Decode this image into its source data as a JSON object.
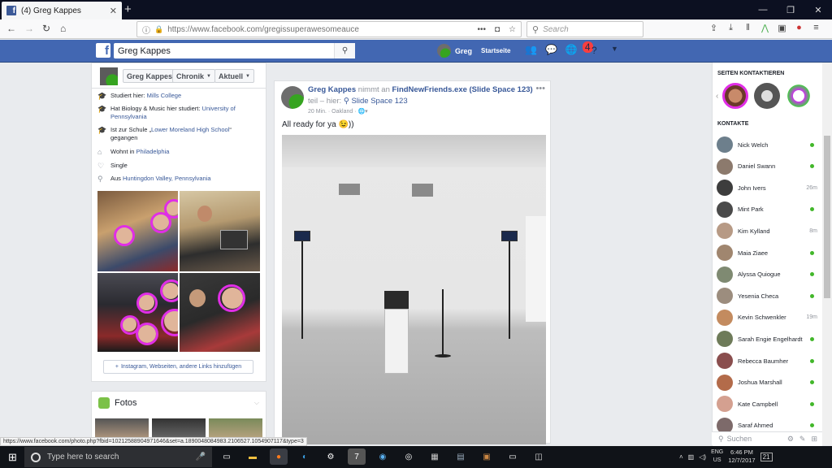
{
  "browser": {
    "tab_title": "(4) Greg Kappes",
    "url": "https://www.facebook.com/gregissuperawesomeauce",
    "search_placeholder": "Search",
    "status_url": "https://www.facebook.com/photo.php?fbid=10212588904971646&set=a.1890048084983.2106527.1054907117&type=3"
  },
  "fb_header": {
    "search_value": "Greg Kappes",
    "user_name": "Greg",
    "home_label": "Startseite",
    "notification_count": "4"
  },
  "profile_header": {
    "name": "Greg Kappes",
    "timeline": "Chronik",
    "current": "Aktuell"
  },
  "intro": [
    {
      "icon": "graduation-cap-icon",
      "text": "Studiert hier: ",
      "link": "Mills College",
      "after": ""
    },
    {
      "icon": "graduation-cap-icon",
      "text": "Hat Biology & Music hier studiert: ",
      "link": "University of Pennsylvania",
      "after": ""
    },
    {
      "icon": "graduation-cap-icon",
      "text": "Ist zur Schule „",
      "link": "Lower Moreland High School",
      "after": "“ gegangen"
    },
    {
      "icon": "home-icon",
      "text": "Wohnt in ",
      "link": "Philadelphia",
      "after": ""
    },
    {
      "icon": "heart-icon",
      "text": "Single",
      "link": "",
      "after": ""
    },
    {
      "icon": "location-pin-icon",
      "text": "Aus ",
      "link": "Huntingdon Valley, Pennsylvania",
      "after": ""
    }
  ],
  "add_links_label": "Instagram, Webseiten, andere Links hinzufügen",
  "fotos_label": "Fotos",
  "post": {
    "author": "Greg Kappes",
    "action_text": " nimmt an ",
    "event": "FindNewFriends.exe (Slide Space 123)",
    "at_prefix": "teil – hier: ",
    "place": "Slide Space 123",
    "meta": "20 Min. · Oakland · ",
    "message": "All ready for ya 😉))"
  },
  "sidebar": {
    "pages_title": "SEITEN KONTAKTIEREN",
    "contacts_title": "KONTAKTE",
    "search_placeholder": "Suchen",
    "contacts": [
      {
        "name": "Nick Welch",
        "status": "online",
        "time": "",
        "color": "#6d7f8c"
      },
      {
        "name": "Daniel Swann",
        "status": "online",
        "time": "",
        "color": "#8c7a6d"
      },
      {
        "name": "John Ivers",
        "status": "idle",
        "time": "26m",
        "color": "#3d3d3d"
      },
      {
        "name": "Mint Park",
        "status": "online",
        "time": "",
        "color": "#4a4a4a"
      },
      {
        "name": "Kim Kylland",
        "status": "idle",
        "time": "8m",
        "color": "#b79a85"
      },
      {
        "name": "Maia Ziaee",
        "status": "online",
        "time": "",
        "color": "#a0866f"
      },
      {
        "name": "Alyssa Quiogue",
        "status": "online",
        "time": "",
        "color": "#7f8a72"
      },
      {
        "name": "Yesenia Checa",
        "status": "online",
        "time": "",
        "color": "#9c8d7e"
      },
      {
        "name": "Kevin Schwenkler",
        "status": "idle",
        "time": "19m",
        "color": "#c38b5f"
      },
      {
        "name": "Sarah Engie Engelhardt",
        "status": "online",
        "time": "",
        "color": "#6e7b59"
      },
      {
        "name": "Rebecca Baumher",
        "status": "online",
        "time": "",
        "color": "#8a4e4e"
      },
      {
        "name": "Joshua Marshall",
        "status": "online",
        "time": "",
        "color": "#b36b4a"
      },
      {
        "name": "Kate Campbell",
        "status": "online",
        "time": "",
        "color": "#d4a090"
      },
      {
        "name": "Saraf Ahmed",
        "status": "online",
        "time": "",
        "color": "#7d6a6a"
      }
    ]
  },
  "taskbar": {
    "search_placeholder": "Type here to search",
    "time": "6:46 PM",
    "date": "12/7/2017",
    "lang_top": "ENG",
    "lang_bottom": "US",
    "notif_count": "21"
  }
}
